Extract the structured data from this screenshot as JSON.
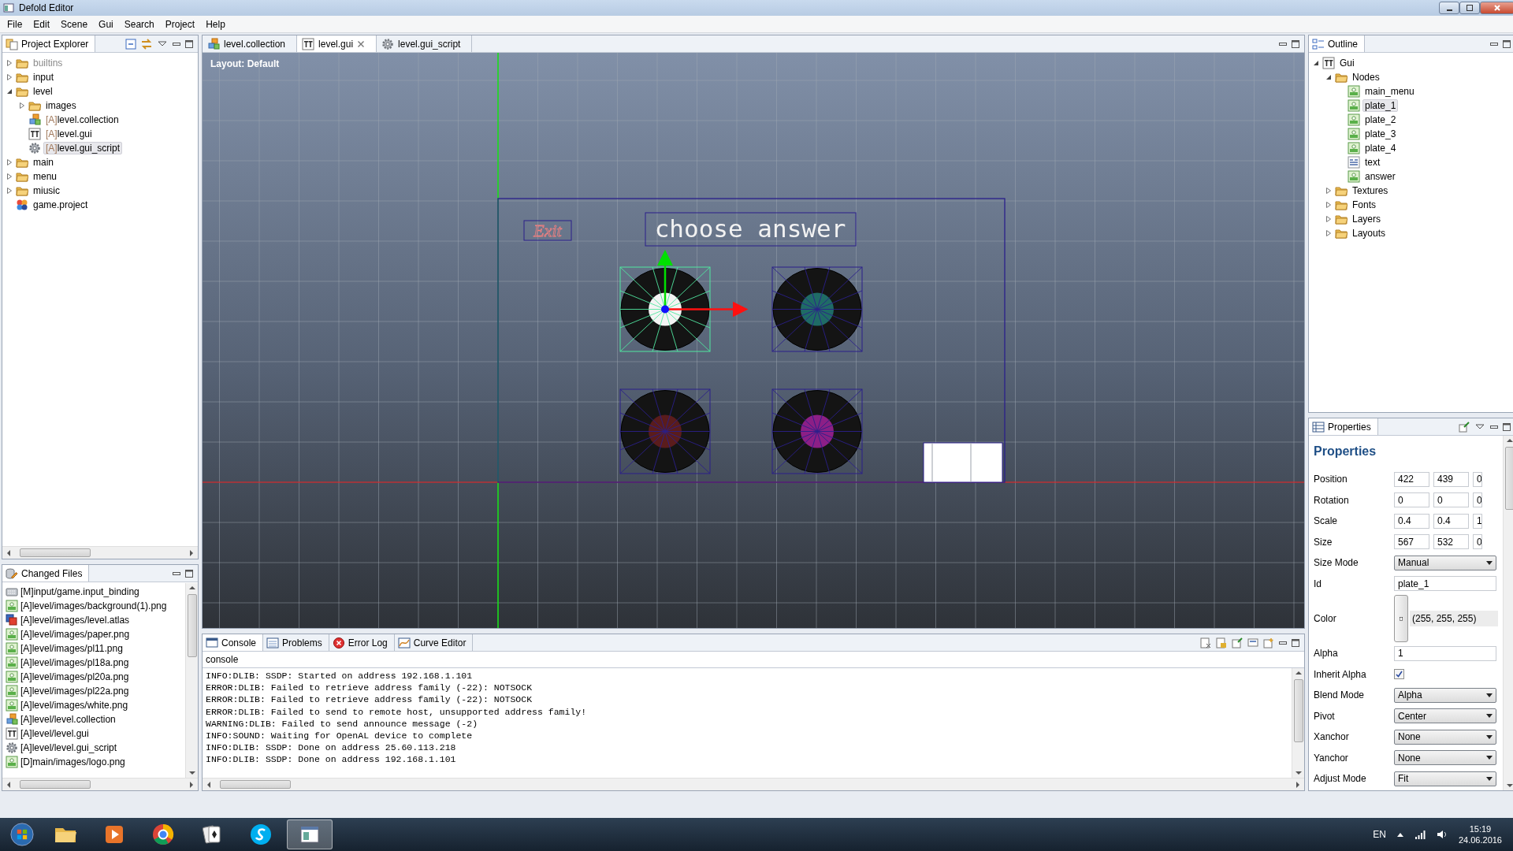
{
  "window": {
    "title": "Defold Editor"
  },
  "menu": [
    "File",
    "Edit",
    "Scene",
    "Gui",
    "Search",
    "Project",
    "Help"
  ],
  "project_explorer": {
    "title": "Project Explorer",
    "tree": [
      {
        "label": "builtins",
        "kind": "folder",
        "expanded": false,
        "muted": true,
        "selected": false
      },
      {
        "label": "input",
        "kind": "folder",
        "expanded": false,
        "muted": false,
        "selected": false
      },
      {
        "label": "level",
        "kind": "folder",
        "expanded": true,
        "muted": false,
        "selected": false,
        "children": [
          {
            "label": "images",
            "kind": "folder",
            "expanded": false,
            "muted": false,
            "selected": false
          },
          {
            "prefix": "[A]",
            "label": "level.collection",
            "kind": "collection",
            "muted": false,
            "selected": false
          },
          {
            "prefix": "[A]",
            "label": "level.gui",
            "kind": "gui",
            "muted": false,
            "selected": false
          },
          {
            "prefix": "[A]",
            "label": "level.gui_script",
            "kind": "script",
            "muted": false,
            "selected": true
          }
        ]
      },
      {
        "label": "main",
        "kind": "folder",
        "expanded": false,
        "muted": false,
        "selected": false
      },
      {
        "label": "menu",
        "kind": "folder",
        "expanded": false,
        "muted": false,
        "selected": false
      },
      {
        "label": "miusic",
        "kind": "folder",
        "expanded": false,
        "muted": false,
        "selected": false
      },
      {
        "label": "game.project",
        "kind": "project",
        "muted": false,
        "selected": false
      }
    ]
  },
  "changed_files": {
    "title": "Changed Files",
    "items": [
      {
        "text": "[M]input/game.input_binding",
        "kind": "binding"
      },
      {
        "text": "[A]level/images/background(1).png",
        "kind": "image"
      },
      {
        "text": "[A]level/images/level.atlas",
        "kind": "atlas"
      },
      {
        "text": "[A]level/images/paper.png",
        "kind": "image"
      },
      {
        "text": "[A]level/images/pl11.png",
        "kind": "image"
      },
      {
        "text": "[A]level/images/pl18a.png",
        "kind": "image"
      },
      {
        "text": "[A]level/images/pl20a.png",
        "kind": "image"
      },
      {
        "text": "[A]level/images/pl22a.png",
        "kind": "image"
      },
      {
        "text": "[A]level/images/white.png",
        "kind": "image"
      },
      {
        "text": "[A]level/level.collection",
        "kind": "collection"
      },
      {
        "text": "[A]level/level.gui",
        "kind": "gui"
      },
      {
        "text": "[A]level/level.gui_script",
        "kind": "script"
      },
      {
        "text": "[D]main/images/logo.png",
        "kind": "image"
      }
    ]
  },
  "editor_tabs": [
    {
      "label": "level.collection",
      "kind": "collection",
      "selected": false,
      "closable": false
    },
    {
      "label": "level.gui",
      "kind": "gui",
      "selected": true,
      "closable": true
    },
    {
      "label": "level.gui_script",
      "kind": "script",
      "selected": false,
      "closable": false
    }
  ],
  "canvas": {
    "layout_label": "Layout: Default",
    "exit_label": "Exit",
    "title_label": "choose answer",
    "plates": [
      {
        "color": "#f4f4f4",
        "selected": true
      },
      {
        "color": "#1f6b66",
        "selected": false
      },
      {
        "color": "#5a1c1c",
        "selected": false
      },
      {
        "color": "#8c1f86",
        "selected": false
      }
    ]
  },
  "console": {
    "tabs": [
      {
        "label": "Console",
        "kind": "console",
        "selected": true
      },
      {
        "label": "Problems",
        "kind": "problems",
        "selected": false
      },
      {
        "label": "Error Log",
        "kind": "error",
        "selected": false
      },
      {
        "label": "Curve Editor",
        "kind": "curve",
        "selected": false
      }
    ],
    "title": "console",
    "lines": [
      "INFO:DLIB: SSDP: Started on address 192.168.1.101",
      "ERROR:DLIB: Failed to retrieve address family (-22): NOTSOCK",
      "ERROR:DLIB: Failed to retrieve address family (-22): NOTSOCK",
      "ERROR:DLIB: Failed to send to remote host, unsupported address family!",
      "WARNING:DLIB: Failed to send announce message (-2)",
      "INFO:SOUND: Waiting for OpenAL device to complete",
      "INFO:DLIB: SSDP: Done on address 25.60.113.218",
      "INFO:DLIB: SSDP: Done on address 192.168.1.101"
    ]
  },
  "outline": {
    "title": "Outline",
    "tree": [
      {
        "label": "Gui",
        "kind": "gui",
        "expanded": true,
        "selected": false,
        "children": [
          {
            "label": "Nodes",
            "kind": "folder",
            "expanded": true,
            "selected": false,
            "children": [
              {
                "label": "main_menu",
                "kind": "image",
                "selected": false
              },
              {
                "label": "plate_1",
                "kind": "image",
                "selected": true
              },
              {
                "label": "plate_2",
                "kind": "image",
                "selected": false
              },
              {
                "label": "plate_3",
                "kind": "image",
                "selected": false
              },
              {
                "label": "plate_4",
                "kind": "image",
                "selected": false
              },
              {
                "label": "text",
                "kind": "text",
                "selected": false
              },
              {
                "label": "answer",
                "kind": "image",
                "selected": false
              }
            ]
          },
          {
            "label": "Textures",
            "kind": "folder",
            "expanded": false,
            "selected": false
          },
          {
            "label": "Fonts",
            "kind": "folder",
            "expanded": false,
            "selected": false
          },
          {
            "label": "Layers",
            "kind": "folder",
            "expanded": false,
            "selected": false
          },
          {
            "label": "Layouts",
            "kind": "folder",
            "expanded": false,
            "selected": false
          }
        ]
      }
    ]
  },
  "properties": {
    "title": "Properties",
    "heading": "Properties",
    "rows": [
      {
        "label": "Position",
        "kind": "vector",
        "values": [
          "422",
          "439",
          "0"
        ]
      },
      {
        "label": "Rotation",
        "kind": "vector",
        "values": [
          "0",
          "0",
          "0"
        ]
      },
      {
        "label": "Scale",
        "kind": "vector",
        "values": [
          "0.4",
          "0.4",
          "1"
        ]
      },
      {
        "label": "Size",
        "kind": "vector",
        "values": [
          "567",
          "532",
          "0"
        ]
      },
      {
        "label": "Size Mode",
        "kind": "select",
        "value": "Manual"
      },
      {
        "label": "Id",
        "kind": "text",
        "value": "plate_1"
      },
      {
        "label": "Color",
        "kind": "color",
        "value": "(255, 255, 255)"
      },
      {
        "label": "Alpha",
        "kind": "text",
        "value": "1"
      },
      {
        "label": "Inherit Alpha",
        "kind": "checkbox",
        "checked": true
      },
      {
        "label": "Blend Mode",
        "kind": "select",
        "value": "Alpha"
      },
      {
        "label": "Pivot",
        "kind": "select",
        "value": "Center"
      },
      {
        "label": "Xanchor",
        "kind": "select",
        "value": "None"
      },
      {
        "label": "Yanchor",
        "kind": "select",
        "value": "None"
      },
      {
        "label": "Adjust Mode",
        "kind": "select",
        "value": "Fit"
      }
    ]
  },
  "taskbar": {
    "apps": [
      {
        "kind": "folder",
        "active": false
      },
      {
        "kind": "player",
        "active": false
      },
      {
        "kind": "browser",
        "active": false
      },
      {
        "kind": "cards",
        "active": false
      },
      {
        "kind": "chat",
        "active": false
      },
      {
        "kind": "window",
        "active": true
      }
    ],
    "language": "EN",
    "time": "15:19",
    "date": "24.06.2016"
  }
}
